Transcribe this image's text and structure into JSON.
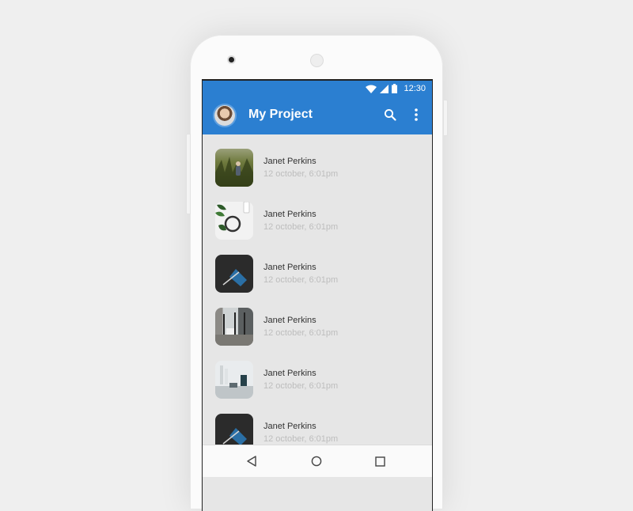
{
  "status_bar": {
    "time": "12:30",
    "icons": [
      "wifi-icon",
      "signal-icon",
      "battery-icon"
    ]
  },
  "app_bar": {
    "title": "My Project",
    "actions": [
      "search-icon",
      "more-vert-icon"
    ],
    "color": "#2b7fd1"
  },
  "list": {
    "items": [
      {
        "name": "Janet Perkins",
        "time": "12 october, 6:01pm",
        "thumb": "field"
      },
      {
        "name": "Janet Perkins",
        "time": "12 october, 6:01pm",
        "thumb": "plant"
      },
      {
        "name": "Janet Perkins",
        "time": "12 october, 6:01pm",
        "thumb": "dark"
      },
      {
        "name": "Janet Perkins",
        "time": "12 october, 6:01pm",
        "thumb": "office"
      },
      {
        "name": "Janet Perkins",
        "time": "12 october, 6:01pm",
        "thumb": "desk"
      },
      {
        "name": "Janet Perkins",
        "time": "12 october, 6:01pm",
        "thumb": "dark"
      }
    ]
  },
  "nav_bar": {
    "icons": [
      "back-icon",
      "home-icon",
      "recents-icon"
    ]
  }
}
